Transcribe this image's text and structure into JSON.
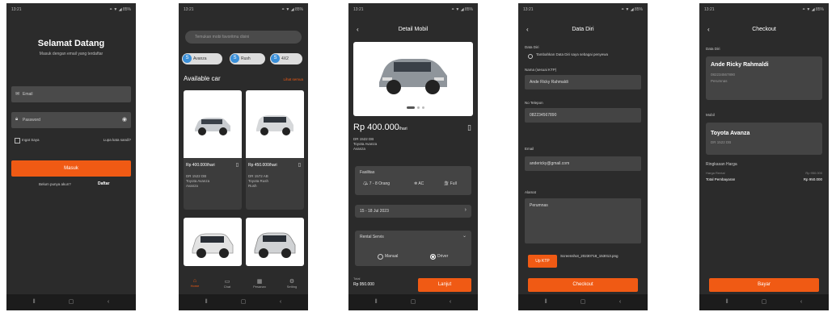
{
  "status": {
    "time": "13:21",
    "icons": "⚭ ▼ ◢ 85%"
  },
  "s1": {
    "title": "Selamat Datang",
    "subtitle": "Masuk dengan email yang terdaftar",
    "email_ph": "Email",
    "password_ph": "Password",
    "remember": "Ingat Saya",
    "forgot": "Lupa kata sandi?",
    "login": "Masuk",
    "no_account": "Belum punya akun?",
    "register": "Daftar"
  },
  "s2": {
    "search_ph": "Temukan mobi favoritmu disini",
    "chips": [
      "Avanza",
      "Rush",
      "4X2"
    ],
    "section": "Available car",
    "see_all": "Lihat semua",
    "cards": [
      {
        "price": "Rp 400.000/hari",
        "plate": "DR 1522 DB",
        "name": "Toyota Avanza",
        "model": "Avanza"
      },
      {
        "price": "Rp 450.000/hari",
        "plate": "DR 1572 AB",
        "name": "Toyota Rush",
        "model": "Rush"
      }
    ],
    "nav": [
      "Home",
      "Chat",
      "Pesanan",
      "Setting"
    ]
  },
  "s3": {
    "title": "Detail Mobil",
    "price": "Rp 400.000",
    "per": "/hari",
    "plate": "DR 1522 DB",
    "name": "Toyota Avanza",
    "model": "Avanza",
    "facilities_label": "Fasilitas",
    "fac_seats": "7 - 8 Orang",
    "fac_ac": "AC",
    "fac_fuel": "Full",
    "date": "15 - 18 Jul 2023",
    "service_label": "Rental Servis",
    "opt_manual": "Manual",
    "opt_driver": "Driver",
    "total_label": "Total",
    "total": "Rp 950.000",
    "btn": "Lanjut"
  },
  "s4": {
    "title": "Data Diri",
    "section": "Data Diri",
    "check": "Tambahkan Data Diri saya sebagai penyewa",
    "name_label": "Nama (sesuai KTP)",
    "name_val": "Ande Ricky Rahmaldi",
    "phone_label": "No Telepon",
    "phone_val": "082234567890",
    "email_label": "Email",
    "email_val": "andericky@gmail.com",
    "address_label": "Alamat",
    "address_val": "Perumnas",
    "upload_btn": "Up KTP",
    "file_name": "Screenshot_20230718_153013.png",
    "btn": "Checkout"
  },
  "s5": {
    "title": "Checkout",
    "section1": "Data Diri",
    "name": "Ande Ricky Rahmaldi",
    "phone": "082234567890",
    "address": "Perumnas",
    "section2": "Mobil",
    "car": "Toyota Avanza",
    "plate": "DR 1522 DB",
    "section3": "Ringkasan Harga",
    "rent_label": "Harga Rental",
    "rent_val": "Rp 950.000",
    "total_label": "Total Pembayaran",
    "total_val": "Rp 950.000",
    "btn": "Bayar"
  },
  "colors": {
    "accent": "#f05a14",
    "bg": "#2b2b2b",
    "field": "#444444"
  }
}
